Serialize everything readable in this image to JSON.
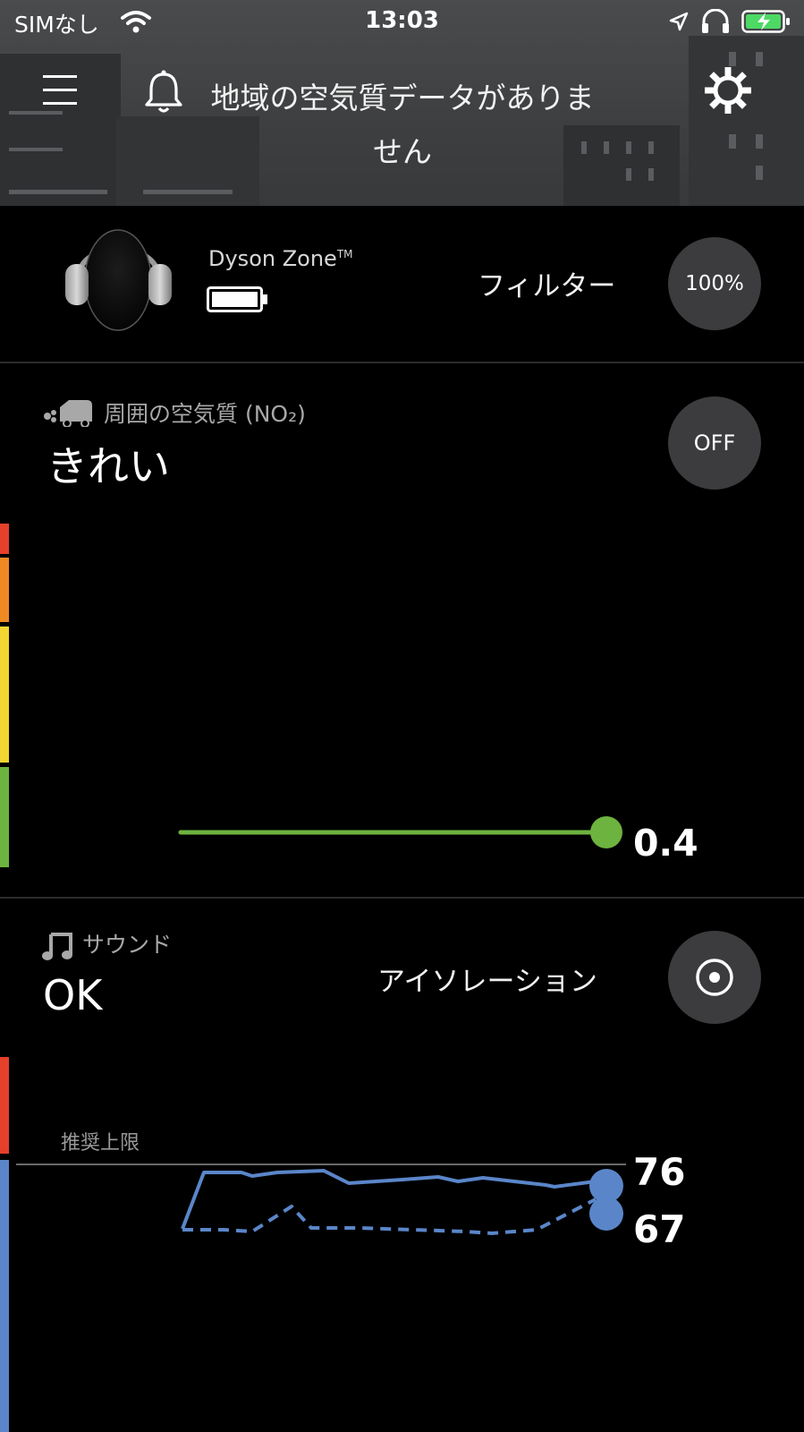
{
  "status_bar": {
    "carrier": "SIMなし",
    "time": "13:03",
    "icons": [
      "wifi-icon",
      "location-arrow-icon",
      "headphones-icon",
      "battery-charging-icon"
    ]
  },
  "header": {
    "title": "地域の空気質データがありません",
    "icons": [
      "menu-icon",
      "bell-icon",
      "gear-icon"
    ]
  },
  "device": {
    "name": "Dyson Zone",
    "trademark": "TM",
    "filter_label": "フィルター",
    "filter_value": "100%"
  },
  "air_quality": {
    "label": "周囲の空気質 (NO₂)",
    "status": "きれい",
    "toggle": "OFF",
    "current_value": "0.4",
    "colors": {
      "line": "#6db33f",
      "scale": [
        "#e5402a",
        "#ef8a23",
        "#f2d530",
        "#6db33f"
      ]
    }
  },
  "sound": {
    "label": "サウンド",
    "status": "OK",
    "mode_label": "アイソレーション",
    "limit_label": "推奨上限",
    "value_upper": "76",
    "value_lower": "67",
    "colors": {
      "line": "#5a86c9",
      "scale": [
        "#e5402a",
        "#5a86c9"
      ]
    }
  }
}
